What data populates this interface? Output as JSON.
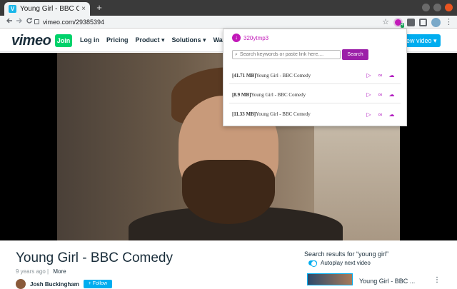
{
  "browser": {
    "tab_title": "Young Girl - BBC Comedy",
    "tab_favicon": "V",
    "tab_close": "×",
    "new_tab": "+",
    "url": "vimeo.com/29385394",
    "back_icon": "arrow-left-icon",
    "forward_icon": "arrow-right-icon",
    "reload_icon": "reload-icon"
  },
  "extension_badge": "4",
  "vimeo": {
    "logo": "vimeo",
    "join": "Join",
    "nav": [
      "Log in",
      "Pricing",
      "Product ▾",
      "Solutions ▾",
      "Watch ▾"
    ],
    "upload": "ew video ▾"
  },
  "video": {
    "title": "Young Girl - BBC Comedy",
    "age": "9 years ago",
    "separator": "|",
    "more": "More",
    "author": "Josh Buckingham",
    "follow": "+ Follow"
  },
  "sidebar": {
    "search_results": "Search results for “young girl”",
    "autoplay": "Autoplay next video",
    "next_title": "Young Girl - BBC ...",
    "next_more": "⋮"
  },
  "popup": {
    "logo": "↓",
    "title": "320ytmp3",
    "search_placeholder": "Search keywords or paste link here....",
    "search_button": "Search",
    "rows": [
      {
        "size": "[41.71 MB]",
        "name": "Young Girl - BBC Comedy"
      },
      {
        "size": "[8.9 MB]",
        "name": "Young Girl - BBC Comedy"
      },
      {
        "size": "[11.33 MB]",
        "name": "Young Girl - BBC Comedy"
      }
    ],
    "action_icons": [
      "play-icon",
      "link-icon",
      "cloud-download-icon"
    ]
  }
}
